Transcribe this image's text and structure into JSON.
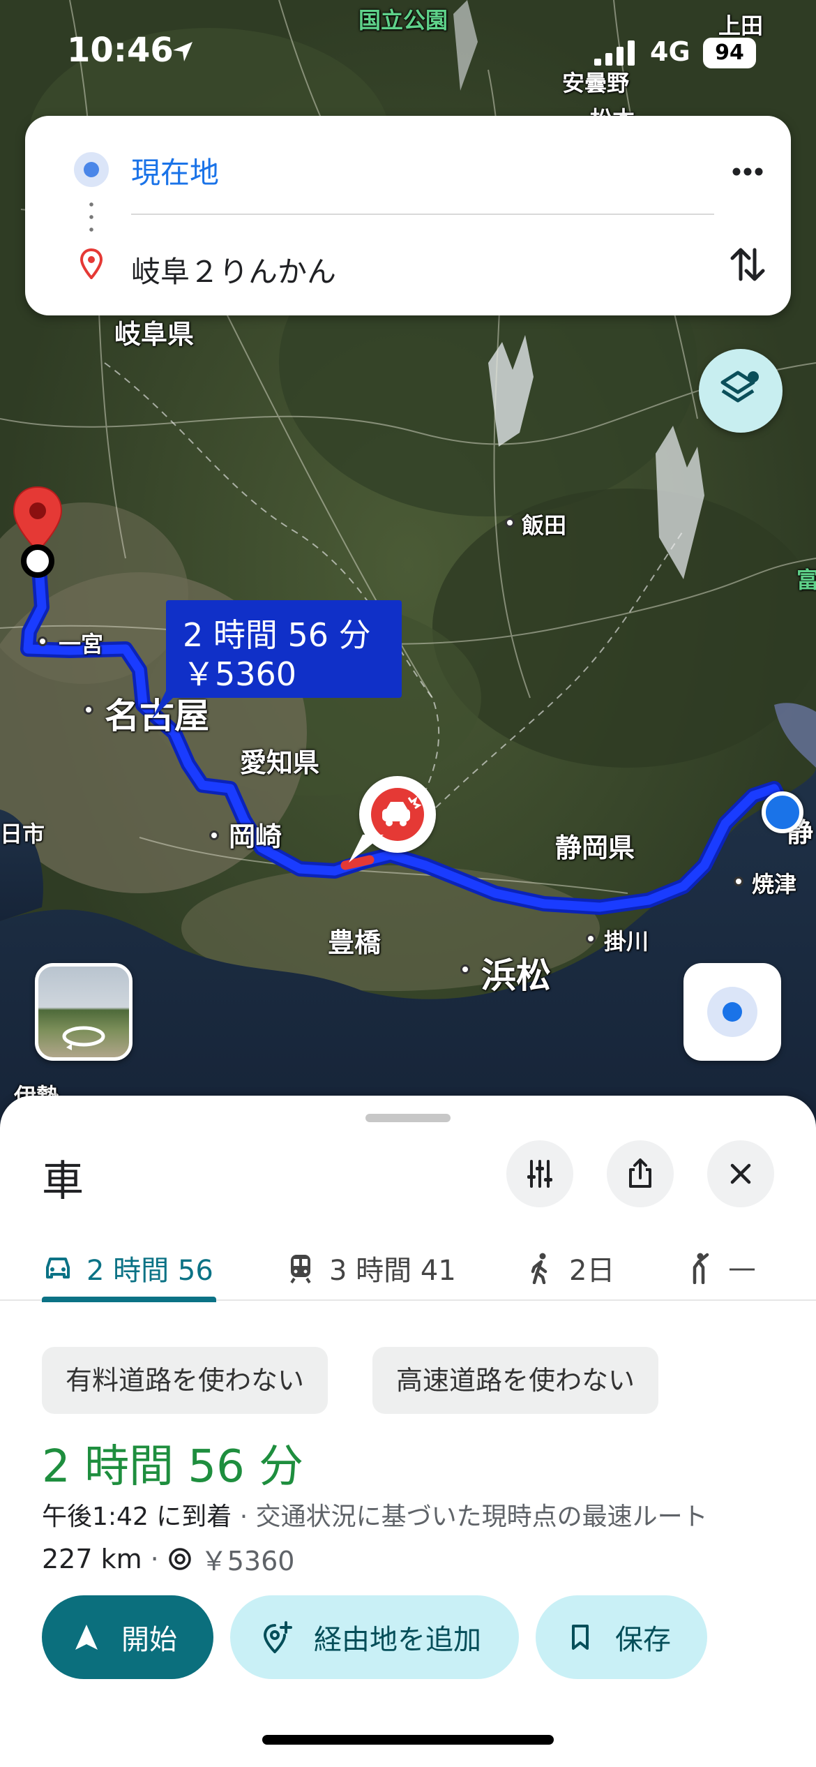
{
  "status_bar": {
    "time": "10:46",
    "network": "4G",
    "battery": "94"
  },
  "route_card": {
    "origin": "現在地",
    "destination": "岐阜２りんかん"
  },
  "map": {
    "labels": {
      "national_park": "国立公園",
      "ueda": "上田",
      "azumino": "安曇野",
      "matsumoto": "松本",
      "gifu_pref": "岐阜県",
      "iida": "飯田",
      "ichinomiya": "一宮",
      "nagoya": "名古屋",
      "aichi_pref": "愛知県",
      "okazaki": "岡崎",
      "shizuoka_pref": "静岡県",
      "yaizu": "焼津",
      "toyohashi": "豊橋",
      "kakegawa": "掛川",
      "hamamatsu": "浜松",
      "kasugai": "日市",
      "ise": "伊勢",
      "shizuoka": "静",
      "fuji": "富"
    },
    "route_bubble": {
      "duration": "2 時間 56 分",
      "toll": "￥5360"
    },
    "colors": {
      "route": "#1a3cff",
      "route_outline": "#0b23b8",
      "destination_pin": "#e53935",
      "incident": "#e53935"
    }
  },
  "sheet": {
    "mode_title": "車",
    "tabs": [
      {
        "label": "2 時間 56",
        "icon": "car-icon"
      },
      {
        "label": "3 時間 41",
        "icon": "train-icon"
      },
      {
        "label": "2日",
        "icon": "walk-icon"
      },
      {
        "label": "—",
        "icon": "ride-hail-icon"
      }
    ],
    "chips": {
      "avoid_tolls": "有料道路を使わない",
      "avoid_highways": "高速道路を使わない"
    },
    "duration": "2 時間 56 分",
    "arrival_time": "午後1:42 に到着",
    "arrival_note": "· 交通状況に基づいた現時点の最速ルート",
    "distance": "227 km",
    "toll_price": "￥5360",
    "actions": {
      "start": "開始",
      "add_waypoint": "経由地を追加",
      "save": "保存"
    }
  }
}
